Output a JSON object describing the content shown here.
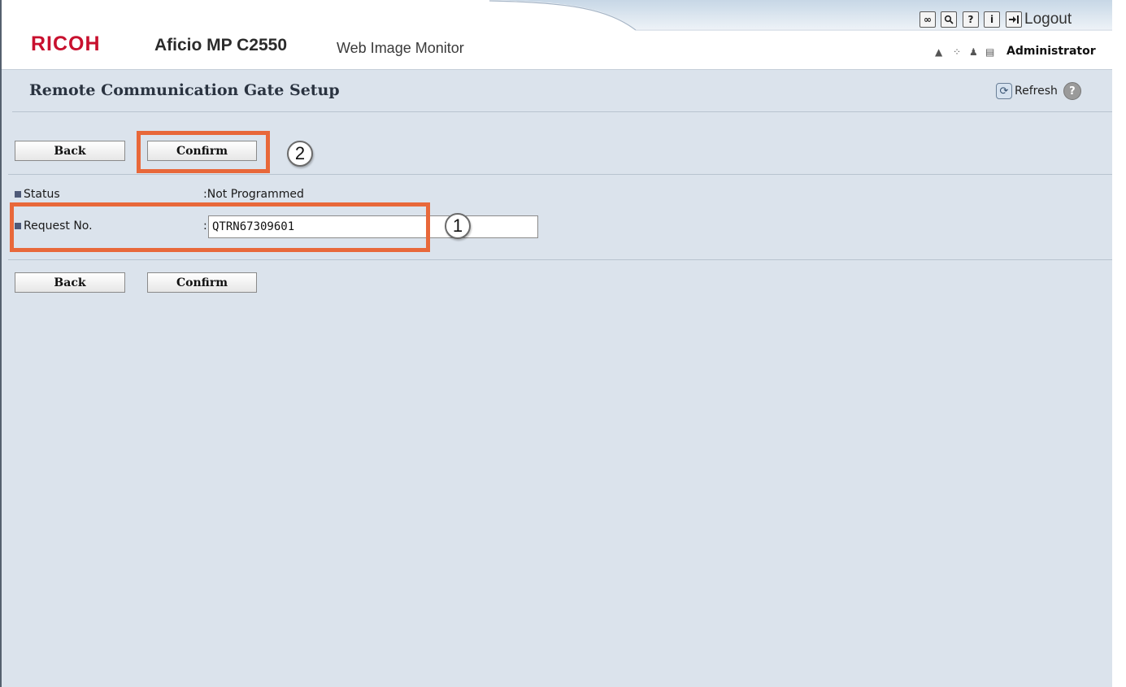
{
  "header": {
    "brand": "RICOH",
    "model": "Aficio MP C2550",
    "product": "Web Image Monitor",
    "toolbar_icons": [
      {
        "name": "link-icon",
        "glyph": "∞"
      },
      {
        "name": "search-icon",
        "glyph": "🔍"
      },
      {
        "name": "help-icon",
        "glyph": "?"
      },
      {
        "name": "info-icon",
        "glyph": "i"
      },
      {
        "name": "logout-icon",
        "glyph": "→|"
      }
    ],
    "logout_label": "Logout",
    "user_label": "Administrator",
    "status_icons": [
      "lock-icon",
      "network-icon",
      "user-icon",
      "document-icon"
    ]
  },
  "page": {
    "title": "Remote Communication Gate Setup",
    "refresh_label": "Refresh"
  },
  "actions_top": {
    "back_label": "Back",
    "confirm_label": "Confirm"
  },
  "actions_bottom": {
    "back_label": "Back",
    "confirm_label": "Confirm"
  },
  "fields": {
    "status": {
      "label": "Status",
      "value": ":Not Programmed"
    },
    "request_no": {
      "label": "Request No.",
      "prefix": ":",
      "value": "QTRN67309601"
    }
  },
  "annotations": {
    "callout_1": "1",
    "callout_2": "2",
    "highlight_color": "#e8683a"
  },
  "colors": {
    "brand_red": "#c8102e",
    "background": "#dbe3ec"
  }
}
